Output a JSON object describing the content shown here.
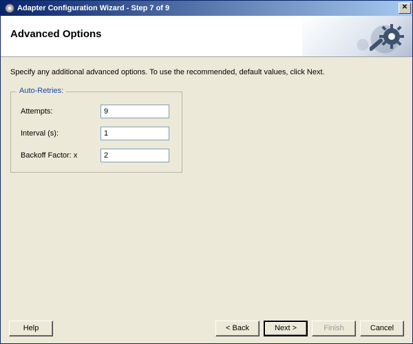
{
  "titlebar": {
    "title": "Adapter Configuration Wizard - Step 7 of 9",
    "close_glyph": "✕"
  },
  "header": {
    "title": "Advanced Options"
  },
  "instruction": "Specify any additional advanced options.  To use the recommended, default values, click Next.",
  "group": {
    "legend": "Auto-Retries:",
    "attempts_label": "Attempts:",
    "attempts_value": "9",
    "interval_label": "Interval (s):",
    "interval_value": "1",
    "backoff_label": "Backoff Factor: x",
    "backoff_value": "2"
  },
  "buttons": {
    "help": "Help",
    "back": "< Back",
    "next": "Next >",
    "finish": "Finish",
    "cancel": "Cancel"
  }
}
